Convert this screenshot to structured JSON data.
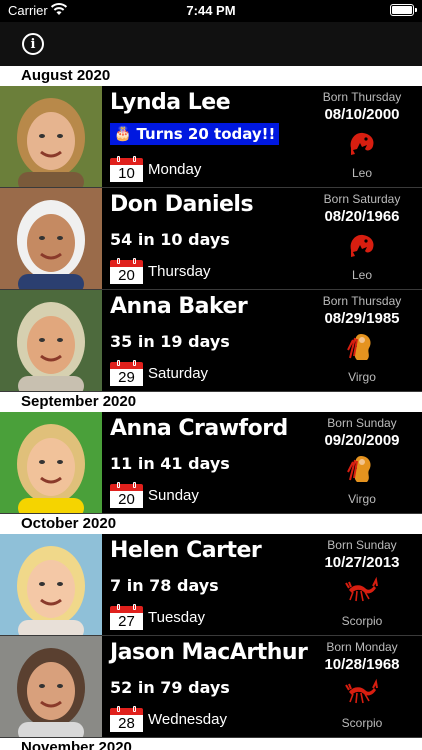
{
  "status": {
    "carrier": "Carrier",
    "time": "7:44 PM"
  },
  "nav": {
    "info_icon": "info-circle-icon",
    "info_glyph": "i"
  },
  "sections": [
    {
      "title": "August 2020",
      "rows": [
        {
          "name": "Lynda Lee",
          "age_text": "",
          "badge": "Turns 20 today!!",
          "day": "10",
          "weekday": "Monday",
          "born_label": "Born Thursday",
          "birth_date": "08/10/2000",
          "zodiac": "Leo",
          "zodiac_icon": "leo-icon"
        },
        {
          "name": "Don Daniels",
          "age_text": "54 in 10 days",
          "badge": "",
          "day": "20",
          "weekday": "Thursday",
          "born_label": "Born Saturday",
          "birth_date": "08/20/1966",
          "zodiac": "Leo",
          "zodiac_icon": "leo-icon"
        },
        {
          "name": "Anna Baker",
          "age_text": "35 in 19 days",
          "badge": "",
          "day": "29",
          "weekday": "Saturday",
          "born_label": "Born Thursday",
          "birth_date": "08/29/1985",
          "zodiac": "Virgo",
          "zodiac_icon": "virgo-icon"
        }
      ]
    },
    {
      "title": "September 2020",
      "rows": [
        {
          "name": "Anna Crawford",
          "age_text": "11 in 41 days",
          "badge": "",
          "day": "20",
          "weekday": "Sunday",
          "born_label": "Born Sunday",
          "birth_date": "09/20/2009",
          "zodiac": "Virgo",
          "zodiac_icon": "virgo-icon"
        }
      ]
    },
    {
      "title": "October 2020",
      "rows": [
        {
          "name": "Helen Carter",
          "age_text": "7 in 78 days",
          "badge": "",
          "day": "27",
          "weekday": "Tuesday",
          "born_label": "Born Sunday",
          "birth_date": "10/27/2013",
          "zodiac": "Scorpio",
          "zodiac_icon": "scorpio-icon"
        },
        {
          "name": "Jason MacArthur",
          "age_text": "52 in 79 days",
          "badge": "",
          "day": "28",
          "weekday": "Wednesday",
          "born_label": "Born Monday",
          "birth_date": "10/28/1968",
          "zodiac": "Scorpio",
          "zodiac_icon": "scorpio-icon"
        }
      ]
    },
    {
      "title": "November 2020",
      "rows": []
    }
  ],
  "colors": {
    "badge_bg": "#0018e0",
    "zodiac": "#d81e10",
    "section_bg": "#ffffff"
  }
}
